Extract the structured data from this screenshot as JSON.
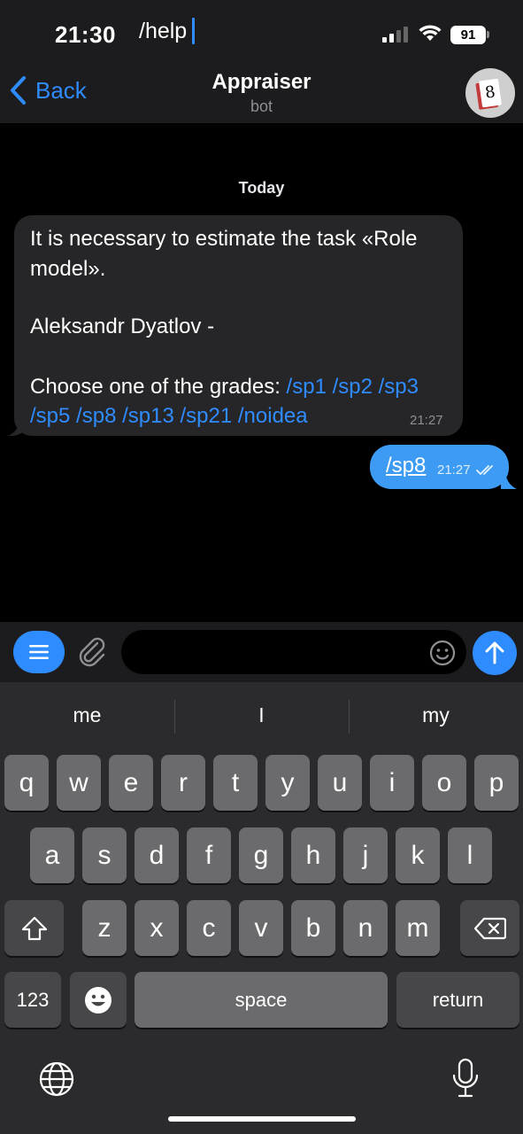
{
  "status_bar": {
    "time": "21:30",
    "battery": "91"
  },
  "nav": {
    "back_label": "Back",
    "title": "Appraiser",
    "subtitle": "bot",
    "avatar_text": "8"
  },
  "chat": {
    "date_label": "Today",
    "incoming": {
      "line1": "It is necessary to estimate the task «Role",
      "line2": "model».",
      "line3": "Aleksandr Dyatlov -",
      "line4_prefix": "Choose one of the grades: ",
      "commands": [
        "/sp1",
        "/sp2",
        "/sp3",
        "/sp5",
        "/sp8",
        "/sp13",
        "/sp21",
        "/noidea"
      ],
      "time": "21:27"
    },
    "outgoing": {
      "text": "/sp8",
      "time": "21:27"
    }
  },
  "input": {
    "value": "/help"
  },
  "keyboard": {
    "suggestions": [
      "me",
      "I",
      "my"
    ],
    "row1": [
      "q",
      "w",
      "e",
      "r",
      "t",
      "y",
      "u",
      "i",
      "o",
      "p"
    ],
    "row2": [
      "a",
      "s",
      "d",
      "f",
      "g",
      "h",
      "j",
      "k",
      "l"
    ],
    "row3": [
      "z",
      "x",
      "c",
      "v",
      "b",
      "n",
      "m"
    ],
    "numbers_label": "123",
    "space_label": "space",
    "return_label": "return"
  }
}
